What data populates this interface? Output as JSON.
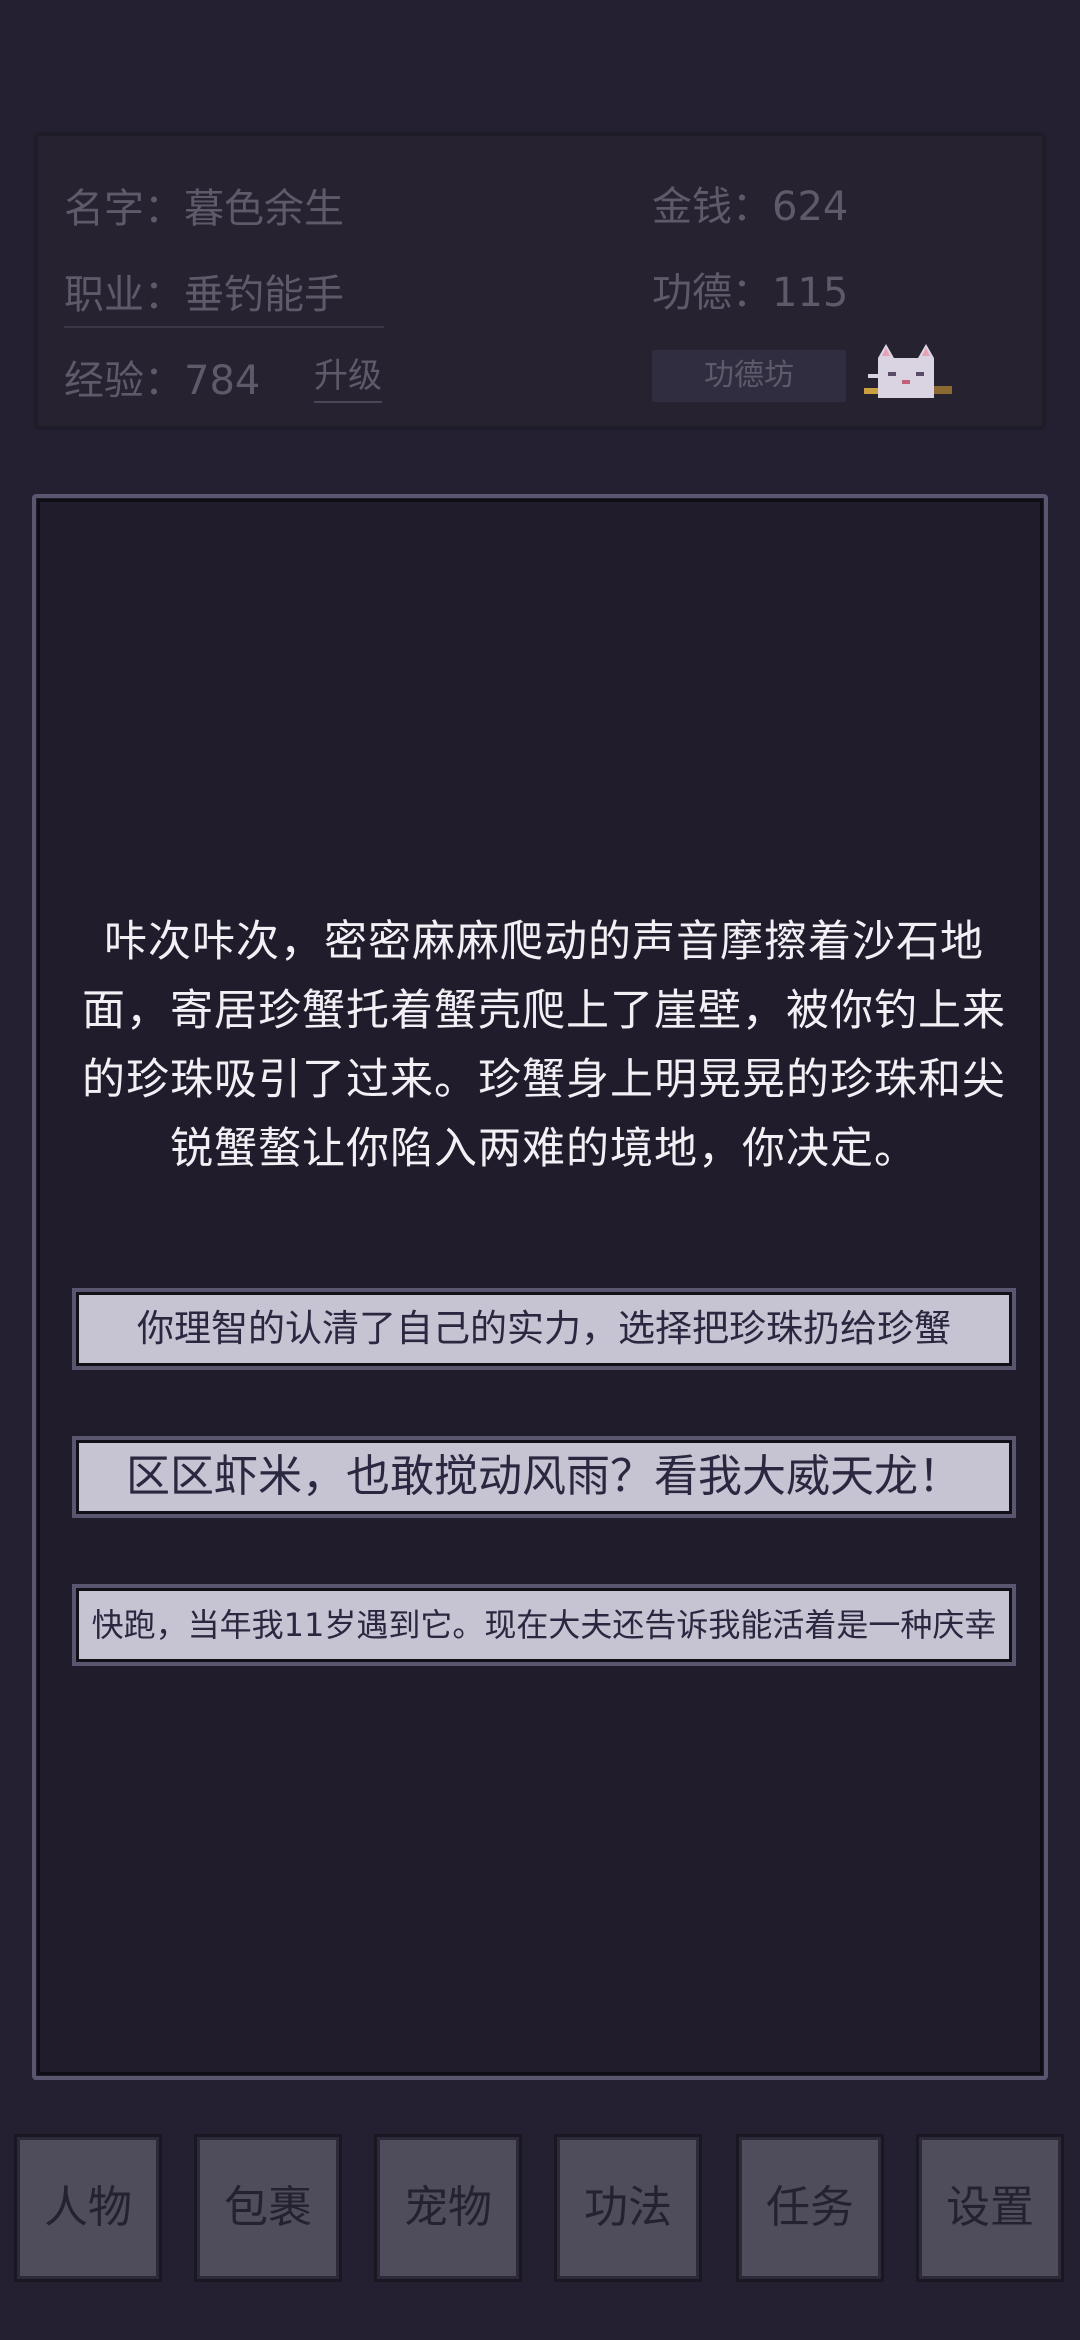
{
  "stats": {
    "name_label": "名字：",
    "name_value": "暮色余生",
    "job_label": "职业：",
    "job_value": "垂钓能手",
    "exp_label": "经验：",
    "exp_value": "784",
    "upgrade_label": "升级",
    "money_label": "金钱：",
    "money_value": "624",
    "merit_label": "功德：",
    "merit_value": "115",
    "merit_shop_label": "功德坊"
  },
  "event": {
    "story": "咔次咔次，密密麻麻爬动的声音摩擦着沙石地面，寄居珍蟹托着蟹壳爬上了崖壁，被你钓上来的珍珠吸引了过来。珍蟹身上明晃晃的珍珠和尖锐蟹螯让你陷入两难的境地，你决定。",
    "choices": [
      "你理智的认清了自己的实力，选择把珍珠扔给珍蟹",
      "区区虾米，也敢搅动风雨？看我大威天龙！",
      "快跑，当年我11岁遇到它。现在大夫还告诉我能活着是一种庆幸"
    ]
  },
  "nav": {
    "items": [
      "人物",
      "包裹",
      "宠物",
      "功法",
      "任务",
      "设置"
    ]
  },
  "colors": {
    "background": "#242031",
    "choice_bg": "#c6c3d2",
    "nav_bg": "#4f4c5c",
    "story_text": "#f2f0f5"
  },
  "icons": {
    "cat": "cat-mascot-icon"
  }
}
